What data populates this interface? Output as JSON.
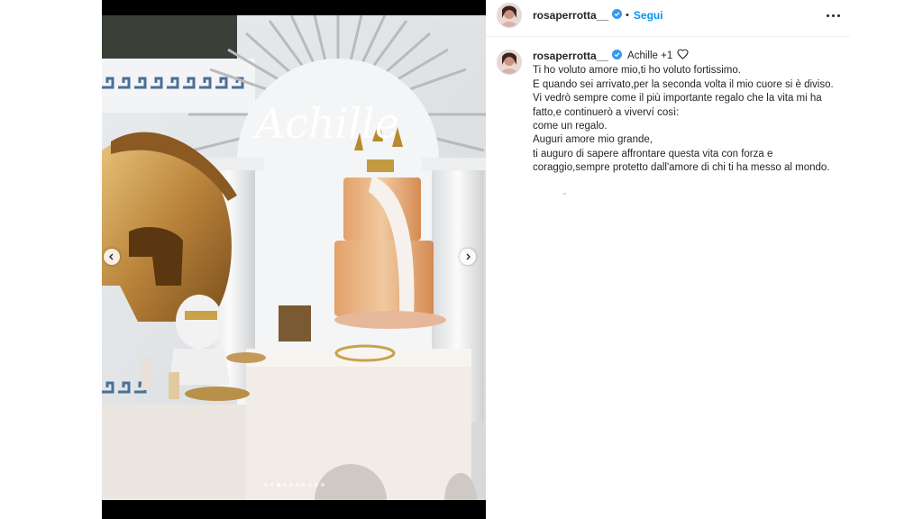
{
  "media": {
    "overlay_text": "Achille",
    "carousel_total": 10,
    "carousel_active_index": 2
  },
  "header": {
    "username": "rosaperrotta__",
    "separator": "•",
    "follow_label": "Segui"
  },
  "caption": {
    "username": "rosaperrotta__",
    "title": "Achille +1",
    "lines": [
      "Ti ho voluto amore mio,ti ho voluto fortissimo.",
      "E quando sei arrivato,per la seconda volta il mio cuore si è diviso.",
      "Vi vedrò sempre come il più importante regalo che la vita mi ha fatto,e continuerò a viverví così:",
      "come un regalo.",
      "Auguri amore mio grande,",
      "ti auguro di sapere affrontare questa vita con forza e coraggio,sempre protetto dall'amore di chi ti ha messo al mondo."
    ]
  },
  "colors": {
    "link_blue": "#0095f6",
    "verified_blue": "#3897f0",
    "text": "#262626",
    "divider": "#efefef"
  },
  "icons": {
    "verified": "verified-badge-icon",
    "more": "more-options-icon",
    "like": "heart-outline-icon",
    "prev": "chevron-left-icon",
    "next": "chevron-right-icon"
  }
}
